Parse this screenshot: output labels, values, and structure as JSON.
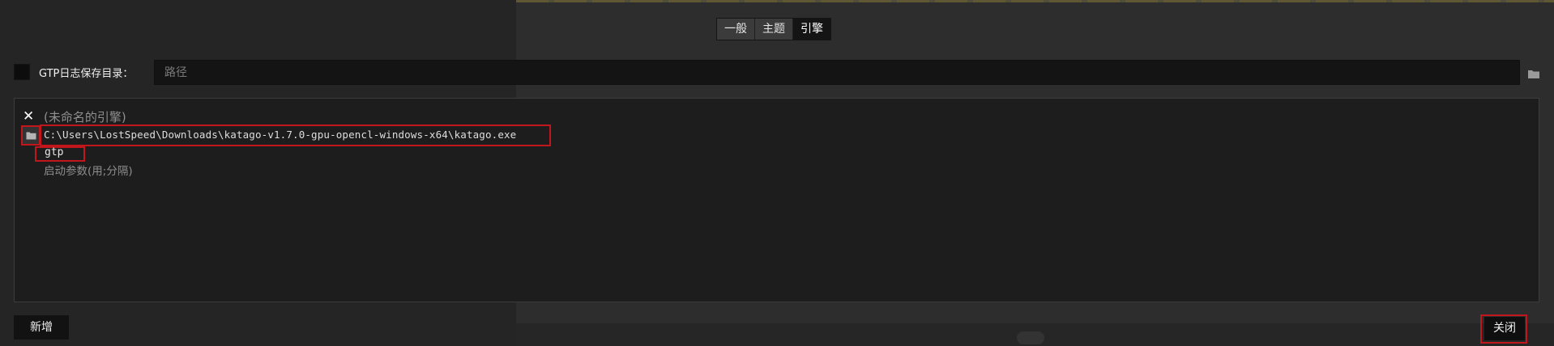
{
  "tabs": [
    {
      "label": "一般"
    },
    {
      "label": "主题"
    },
    {
      "label": "引擎"
    }
  ],
  "active_tab": "引擎",
  "gtp_log": {
    "label": "GTP日志保存目录：",
    "checked": false,
    "path_value": "",
    "path_placeholder": "路径"
  },
  "engine": {
    "name": "(未命名的引擎)",
    "executable_path": "C:\\Users\\LostSpeed\\Downloads\\katago-v1.7.0-gpu-opencl-windows-x64\\katago.exe",
    "command": "gtp",
    "args_placeholder": "启动参数(用;分隔)"
  },
  "buttons": {
    "add_label": "新增",
    "close_label": "关闭"
  },
  "colors": {
    "highlight": "#c0161c",
    "background": "#272727",
    "panel": "#1d1d1d"
  }
}
